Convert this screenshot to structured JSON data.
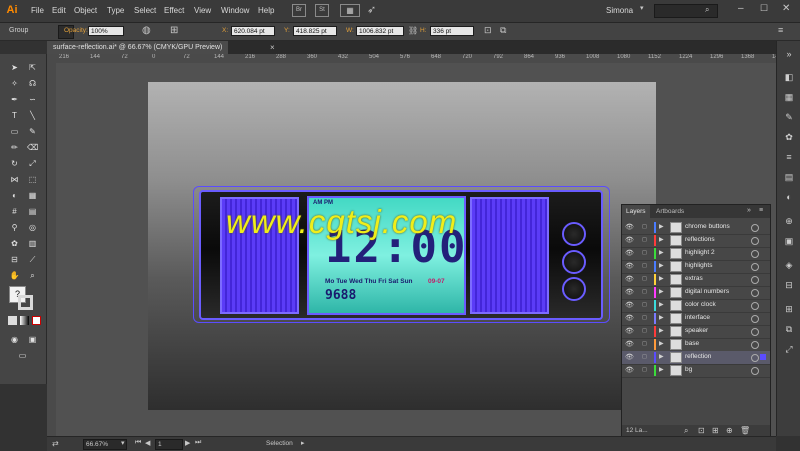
{
  "app": {
    "logo": "Ai"
  },
  "menu": [
    "File",
    "Edit",
    "Object",
    "Type",
    "Select",
    "Effect",
    "View",
    "Window",
    "Help"
  ],
  "bridge": [
    "Br",
    "St"
  ],
  "user": "Simona",
  "control": {
    "selection_type": "Group",
    "opacity_label": "Opacity:",
    "opacity_value": "100%",
    "x_label": "X:",
    "x_value": "620.084 pt",
    "y_label": "Y:",
    "y_value": "418.825 pt",
    "w_label": "W:",
    "w_value": "1006.832 pt",
    "h_label": "H:",
    "h_value": "336 pt"
  },
  "document": {
    "tab_title": "surface-reflection.ai* @ 66.67% (CMYK/GPU Preview)"
  },
  "ruler": [
    "216",
    "144",
    "72",
    "0",
    "72",
    "144",
    "216",
    "288",
    "360",
    "432",
    "504",
    "576",
    "648",
    "720",
    "792",
    "864",
    "936",
    "1008",
    "1080",
    "1152",
    "1224",
    "1296",
    "1368",
    "1440"
  ],
  "lcd": {
    "digits": "12:00",
    "days": "Mo  Tue  Wed  Thu  Fri  Sat  Sun",
    "ampm": "AM  PM",
    "date": "09-07",
    "small_number": "9688"
  },
  "watermark": "www.cgtsj.com",
  "layers_panel": {
    "tab_layers": "Layers",
    "tab_artboards": "Artboards",
    "count": "12 La...",
    "items": [
      {
        "name": "chrome buttons",
        "color": "#4a7cff",
        "selected": false
      },
      {
        "name": "reflections",
        "color": "#ff3b3b",
        "selected": false
      },
      {
        "name": "highlight 2",
        "color": "#3bdc3b",
        "selected": false
      },
      {
        "name": "highlights",
        "color": "#4a7cff",
        "selected": false
      },
      {
        "name": "extras",
        "color": "#ffd23b",
        "selected": false
      },
      {
        "name": "digital numbers",
        "color": "#ff3bff",
        "selected": false
      },
      {
        "name": "color clock",
        "color": "#3bdcdc",
        "selected": false
      },
      {
        "name": "interface",
        "color": "#7a7aff",
        "selected": false
      },
      {
        "name": "speaker",
        "color": "#ff3b3b",
        "selected": false
      },
      {
        "name": "base",
        "color": "#ff9a3b",
        "selected": false
      },
      {
        "name": "reflection",
        "color": "#5b4cff",
        "selected": true
      },
      {
        "name": "bg",
        "color": "#3bdc3b",
        "selected": false
      }
    ]
  },
  "status": {
    "zoom": "66.67%",
    "artboard": "1",
    "tool": "Selection"
  }
}
